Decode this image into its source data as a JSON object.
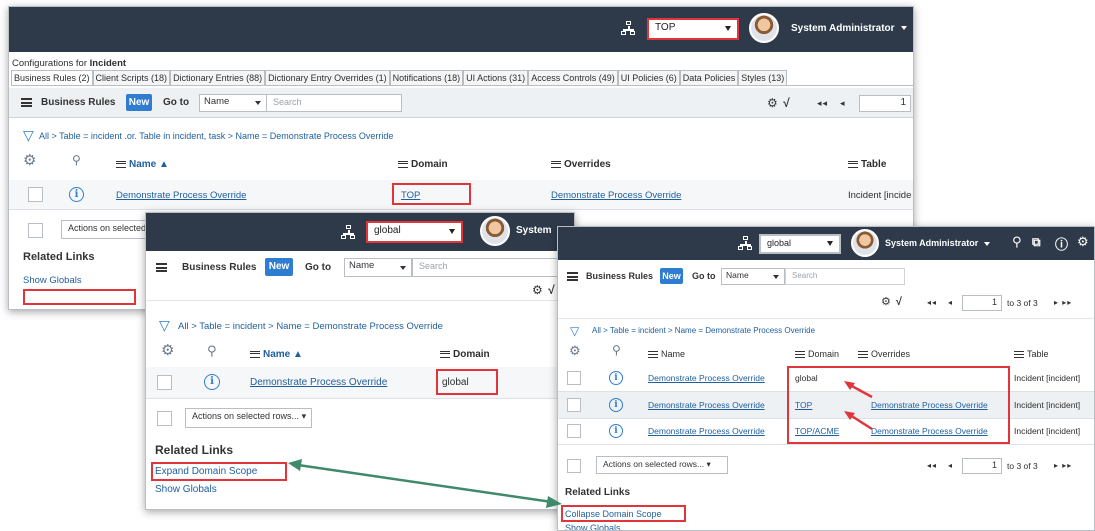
{
  "panel_top": {
    "scope": "TOP",
    "user": "System Administrator",
    "configurations_prefix": "Configurations for",
    "configurations_table": "Incident",
    "tabs": [
      "Business Rules (2)",
      "Client Scripts (18)",
      "Dictionary Entries (88)",
      "Dictionary Entry Overrides (1)",
      "Notifications (18)",
      "UI Actions (31)",
      "Access Controls (49)",
      "UI Policies (6)",
      "Data Policies",
      "Styles (13)"
    ],
    "list_title": "Business Rules",
    "new_label": "New",
    "goto_label": "Go to",
    "goto_field": "Name",
    "search_placeholder": "Search",
    "page_number": "1",
    "breadcrumb": "All > Table = incident .or. Table in incident, task > Name = Demonstrate Process Override",
    "columns": [
      "Name ▲",
      "Domain",
      "Overrides",
      "Table"
    ],
    "row": {
      "name": "Demonstrate Process Override",
      "domain": "TOP",
      "overrides": "Demonstrate Process Override",
      "table": "Incident [incide"
    },
    "actions_label": "Actions on selected",
    "related_links": "Related Links",
    "show_globals": "Show Globals"
  },
  "panel_mid": {
    "scope": "global",
    "user": "System",
    "list_title": "Business Rules",
    "new_label": "New",
    "goto_label": "Go to",
    "goto_field": "Name",
    "search_placeholder": "Search",
    "breadcrumb": "All > Table = incident > Name = Demonstrate Process Override",
    "columns": [
      "Name ▲",
      "Domain"
    ],
    "row": {
      "name": "Demonstrate Process Override",
      "domain": "global"
    },
    "actions_label": "Actions on selected rows...",
    "related_links": "Related Links",
    "expand_scope": "Expand Domain Scope",
    "show_globals": "Show Globals"
  },
  "panel_right": {
    "scope": "global",
    "user": "System Administrator",
    "list_title": "Business Rules",
    "new_label": "New",
    "goto_label": "Go to",
    "goto_field": "Name",
    "search_placeholder": "Search",
    "page_number": "1",
    "page_range": "to 3 of 3",
    "breadcrumb": "All > Table = incident > Name = Demonstrate Process Override",
    "columns": [
      "Name",
      "Domain",
      "Overrides",
      "Table"
    ],
    "rows": [
      {
        "name": "Demonstrate Process Override",
        "domain": "global",
        "overrides": "",
        "table": "Incident [incident]"
      },
      {
        "name": "Demonstrate Process Override",
        "domain": "TOP",
        "overrides": "Demonstrate Process Override",
        "table": "Incident [incident]"
      },
      {
        "name": "Demonstrate Process Override",
        "domain": "TOP/ACME",
        "overrides": "Demonstrate Process Override",
        "table": "Incident [incident]"
      }
    ],
    "actions_label": "Actions on selected rows...",
    "related_links": "Related Links",
    "collapse_scope": "Collapse Domain Scope",
    "show_globals": "Show Globals"
  },
  "colors": {
    "header": "#2e3a4a",
    "highlight": "#e0363b",
    "link": "#1f5f9e",
    "new_button": "#2f7dd1",
    "arrow": "#3f8a6b"
  }
}
